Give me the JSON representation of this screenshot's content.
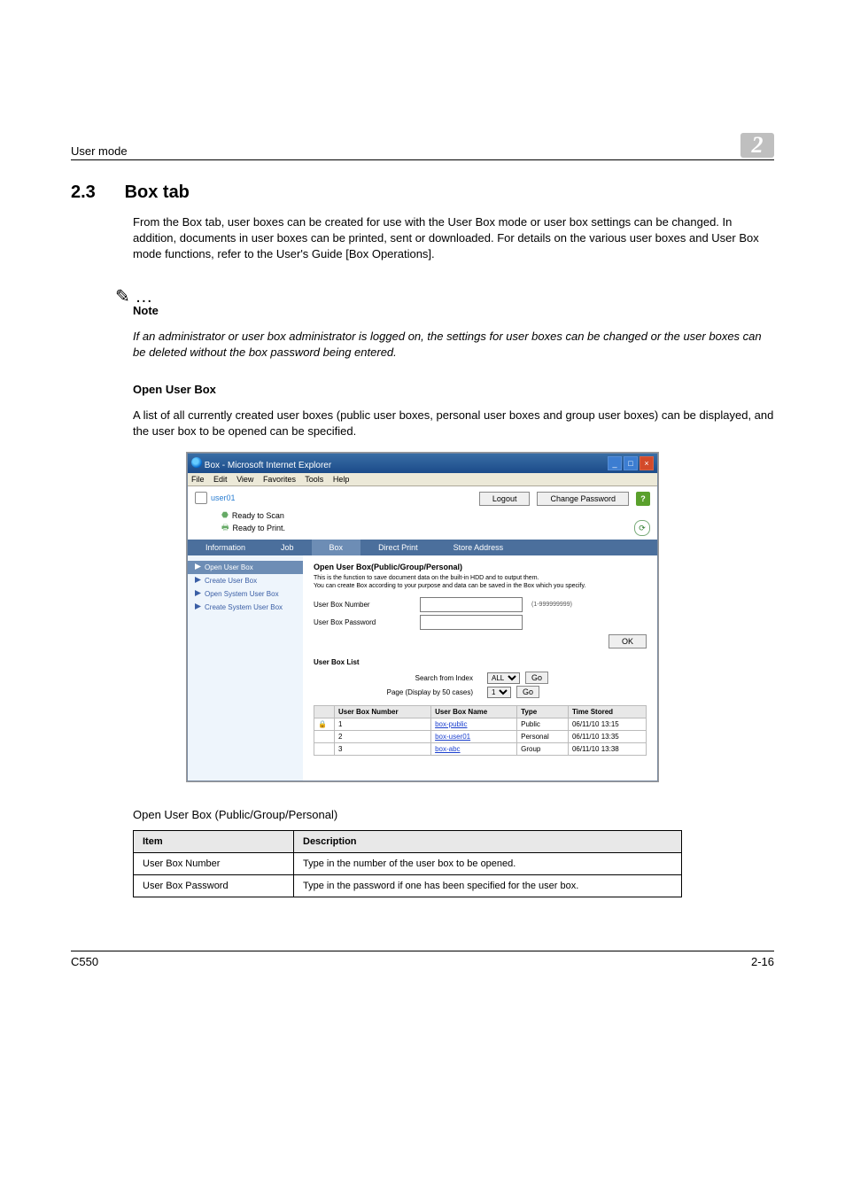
{
  "header": {
    "left": "User mode",
    "badge": "2"
  },
  "section": {
    "num": "2.3",
    "title": "Box tab"
  },
  "intro": "From the Box tab, user boxes can be created for use with the User Box mode or user box settings can be changed. In addition, documents in user boxes can be printed, sent or downloaded. For details on the various user boxes and User Box mode functions, refer to the User's Guide [Box Operations].",
  "note": {
    "glyph": "✎ …",
    "head": "Note",
    "body": "If an administrator or user box administrator is logged on, the settings for user boxes can be changed or the user boxes can be deleted without the box password being entered."
  },
  "sub1": {
    "head": "Open User Box",
    "body": "A list of all currently created user boxes (public user boxes, personal user boxes and group user boxes) can be displayed, and the user box to be opened can be specified."
  },
  "shot": {
    "title": "Box - Microsoft Internet Explorer",
    "menu": [
      "File",
      "Edit",
      "View",
      "Favorites",
      "Tools",
      "Help"
    ],
    "username": "user01",
    "btn_logout": "Logout",
    "btn_changepw": "Change Password",
    "status_scan": "Ready to Scan",
    "status_print": "Ready to Print.",
    "tabs": [
      "Information",
      "Job",
      "Box",
      "Direct Print",
      "Store Address"
    ],
    "sidenav": [
      "Open User Box",
      "Create User Box",
      "Open System User Box",
      "Create System User Box"
    ],
    "panel_title": "Open User Box(Public/Group/Personal)",
    "panel_desc1": "This is the function to save document data on the built-in HDD and to output them.",
    "panel_desc2": "You can create Box according to your purpose and data can be saved in the Box which you specify.",
    "lbl_num": "User Box Number",
    "hint_num": "(1-999999999)",
    "lbl_pw": "User Box Password",
    "btn_ok": "OK",
    "list_head": "User Box List",
    "lbl_search": "Search from Index",
    "sel_search": "ALL",
    "lbl_page": "Page (Display by 50 cases)",
    "sel_page": "1",
    "btn_go": "Go",
    "cols": {
      "num": "User Box Number",
      "name": "User Box Name",
      "type": "Type",
      "time": "Time Stored"
    },
    "rows": [
      {
        "lock": true,
        "num": "1",
        "name": "box-public",
        "type": "Public",
        "time": "06/11/10 13:15"
      },
      {
        "lock": false,
        "num": "2",
        "name": "box-user01",
        "type": "Personal",
        "time": "06/11/10 13:35"
      },
      {
        "lock": false,
        "num": "3",
        "name": "box-abc",
        "type": "Group",
        "time": "06/11/10 13:38"
      }
    ]
  },
  "caption": "Open User Box (Public/Group/Personal)",
  "table": {
    "h1": "Item",
    "h2": "Description",
    "r": [
      {
        "i": "User Box Number",
        "d": "Type in the number of the user box to be opened."
      },
      {
        "i": "User Box Password",
        "d": "Type in the password if one has been specified for the user box."
      }
    ]
  },
  "footer": {
    "left": "C550",
    "right": "2-16"
  }
}
